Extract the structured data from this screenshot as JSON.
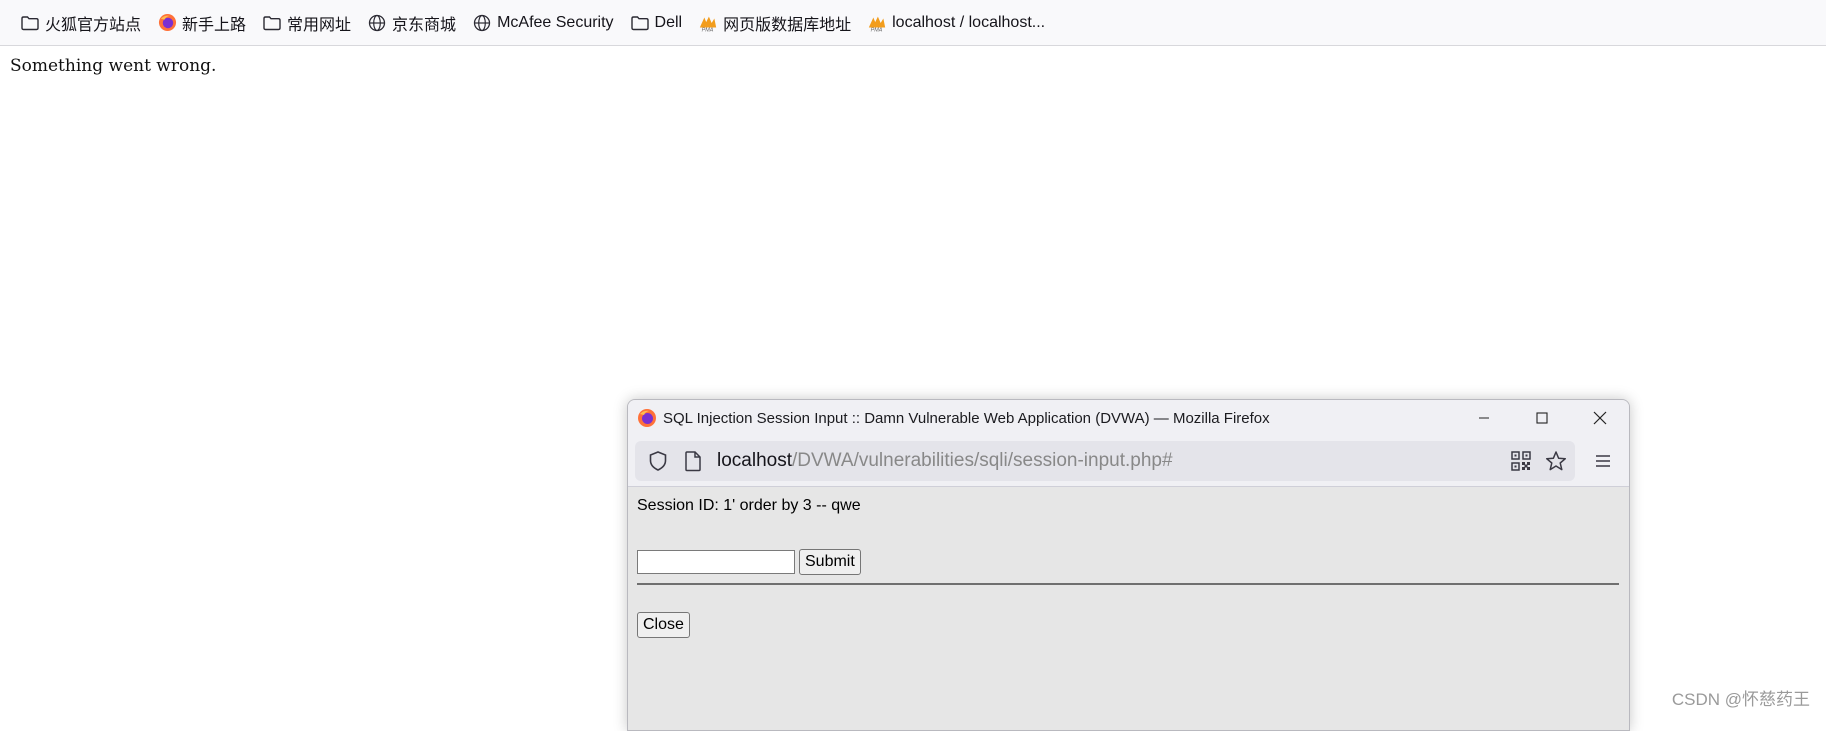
{
  "bookmarks": [
    {
      "label": "火狐官方站点",
      "icon": "folder-icon"
    },
    {
      "label": "新手上路",
      "icon": "firefox-icon"
    },
    {
      "label": "常用网址",
      "icon": "folder-icon"
    },
    {
      "label": "京东商城",
      "icon": "globe-icon"
    },
    {
      "label": "McAfee Security",
      "icon": "globe-icon"
    },
    {
      "label": "Dell",
      "icon": "folder-icon"
    },
    {
      "label": "网页版数据库地址",
      "icon": "pma-icon"
    },
    {
      "label": "localhost / localhost...",
      "icon": "pma-icon"
    }
  ],
  "page": {
    "error_text": "Something went wrong."
  },
  "popup": {
    "title": "SQL Injection Session Input :: Damn Vulnerable Web Application (DVWA) — Mozilla Firefox",
    "url_host": "localhost",
    "url_path": "/DVWA/vulnerabilities/sqli/session-input.php#",
    "session_text": "Session ID: 1' order by 3 -- qwe",
    "input_value": "",
    "submit_label": "Submit",
    "close_label": "Close"
  },
  "watermark": "CSDN @怀慈药王",
  "colors": {
    "popup_bg": "#e6e6e6",
    "chrome_bg": "#f0f0f4",
    "url_field_bg": "#e4e4ea"
  }
}
